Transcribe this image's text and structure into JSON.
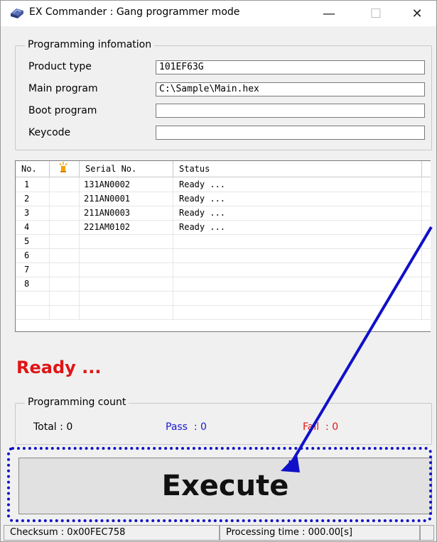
{
  "window": {
    "title": "EX Commander : Gang programmer mode",
    "controls": {
      "minimize": "—",
      "maximize": "☐",
      "close": "✕"
    }
  },
  "programming_info": {
    "legend": "Programming infomation",
    "fields": [
      {
        "label": "Product type",
        "value": "101EF63G"
      },
      {
        "label": "Main program",
        "value": "C:\\Sample\\Main.hex"
      },
      {
        "label": "Boot program",
        "value": ""
      },
      {
        "label": "Keycode",
        "value": ""
      }
    ]
  },
  "table": {
    "columns": {
      "no": "No.",
      "icon": "lamp-icon",
      "serial": "Serial No.",
      "status": "Status"
    },
    "rows": [
      {
        "no": "1",
        "serial": "131AN0002",
        "status": "Ready ..."
      },
      {
        "no": "2",
        "serial": "211AN0001",
        "status": "Ready ..."
      },
      {
        "no": "3",
        "serial": "211AN0003",
        "status": "Ready ..."
      },
      {
        "no": "4",
        "serial": "221AM0102",
        "status": "Ready ..."
      },
      {
        "no": "5",
        "serial": "",
        "status": ""
      },
      {
        "no": "6",
        "serial": "",
        "status": ""
      },
      {
        "no": "7",
        "serial": "",
        "status": ""
      },
      {
        "no": "8",
        "serial": "",
        "status": ""
      }
    ]
  },
  "status_message": "Ready ...",
  "programming_count": {
    "legend": "Programming count",
    "total": "Total : 0",
    "pass": "Pass  : 0",
    "fail": "Fail  : 0"
  },
  "execute_label": "Execute",
  "statusbar": {
    "checksum": "Checksum :  0x00FEC758",
    "processing_time": "Processing time :  000.00[s]"
  },
  "colors": {
    "status_red": "#e01515",
    "pass_blue": "#1a1acc",
    "fail_red": "#e01515",
    "highlight_blue": "#1010c8"
  }
}
